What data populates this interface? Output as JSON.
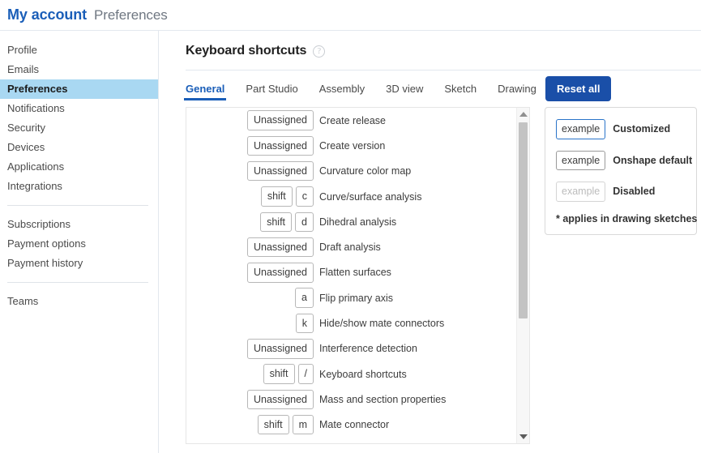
{
  "header": {
    "account_title": "My account",
    "page_title": "Preferences"
  },
  "sidebar": {
    "group1": [
      {
        "label": "Profile",
        "active": false
      },
      {
        "label": "Emails",
        "active": false
      },
      {
        "label": "Preferences",
        "active": true
      },
      {
        "label": "Notifications",
        "active": false
      },
      {
        "label": "Security",
        "active": false
      },
      {
        "label": "Devices",
        "active": false
      },
      {
        "label": "Applications",
        "active": false
      },
      {
        "label": "Integrations",
        "active": false
      }
    ],
    "group2": [
      {
        "label": "Subscriptions",
        "active": false
      },
      {
        "label": "Payment options",
        "active": false
      },
      {
        "label": "Payment history",
        "active": false
      }
    ],
    "group3": [
      {
        "label": "Teams",
        "active": false
      }
    ]
  },
  "main": {
    "section_title": "Keyboard shortcuts",
    "help_icon": "question-circle-icon",
    "reset_all_label": "Reset all",
    "tabs": [
      {
        "label": "General",
        "active": true
      },
      {
        "label": "Part Studio",
        "active": false
      },
      {
        "label": "Assembly",
        "active": false
      },
      {
        "label": "3D view",
        "active": false
      },
      {
        "label": "Sketch",
        "active": false
      },
      {
        "label": "Drawing",
        "active": false
      }
    ],
    "shortcuts": [
      {
        "keys": [
          "Unassigned"
        ],
        "action": "Create release"
      },
      {
        "keys": [
          "Unassigned"
        ],
        "action": "Create version"
      },
      {
        "keys": [
          "Unassigned"
        ],
        "action": "Curvature color map"
      },
      {
        "keys": [
          "shift",
          "c"
        ],
        "action": "Curve/surface analysis"
      },
      {
        "keys": [
          "shift",
          "d"
        ],
        "action": "Dihedral analysis"
      },
      {
        "keys": [
          "Unassigned"
        ],
        "action": "Draft analysis"
      },
      {
        "keys": [
          "Unassigned"
        ],
        "action": "Flatten surfaces"
      },
      {
        "keys": [
          "a"
        ],
        "action": "Flip primary axis"
      },
      {
        "keys": [
          "k"
        ],
        "action": "Hide/show mate connectors"
      },
      {
        "keys": [
          "Unassigned"
        ],
        "action": "Interference detection"
      },
      {
        "keys": [
          "shift",
          "/"
        ],
        "action": "Keyboard shortcuts"
      },
      {
        "keys": [
          "Unassigned"
        ],
        "action": "Mass and section properties"
      },
      {
        "keys": [
          "shift",
          "m"
        ],
        "action": "Mate connector"
      }
    ],
    "scrollbar": {
      "up_arrow": "scroll-up-arrow-icon",
      "down_arrow": "scroll-down-arrow-icon"
    }
  },
  "legend": {
    "rows": [
      {
        "chip": "example",
        "label": "Customized",
        "state": "customized"
      },
      {
        "chip": "example",
        "label": "Onshape default",
        "state": "default"
      },
      {
        "chip": "example",
        "label": "Disabled",
        "state": "disabled"
      }
    ],
    "footnote": "* applies in drawing sketches"
  },
  "colors": {
    "brand_blue": "#1a5eb8",
    "button_blue": "#1a4fa8",
    "active_nav_bg": "#a9d8f2",
    "customized_border": "#2a74c9"
  }
}
